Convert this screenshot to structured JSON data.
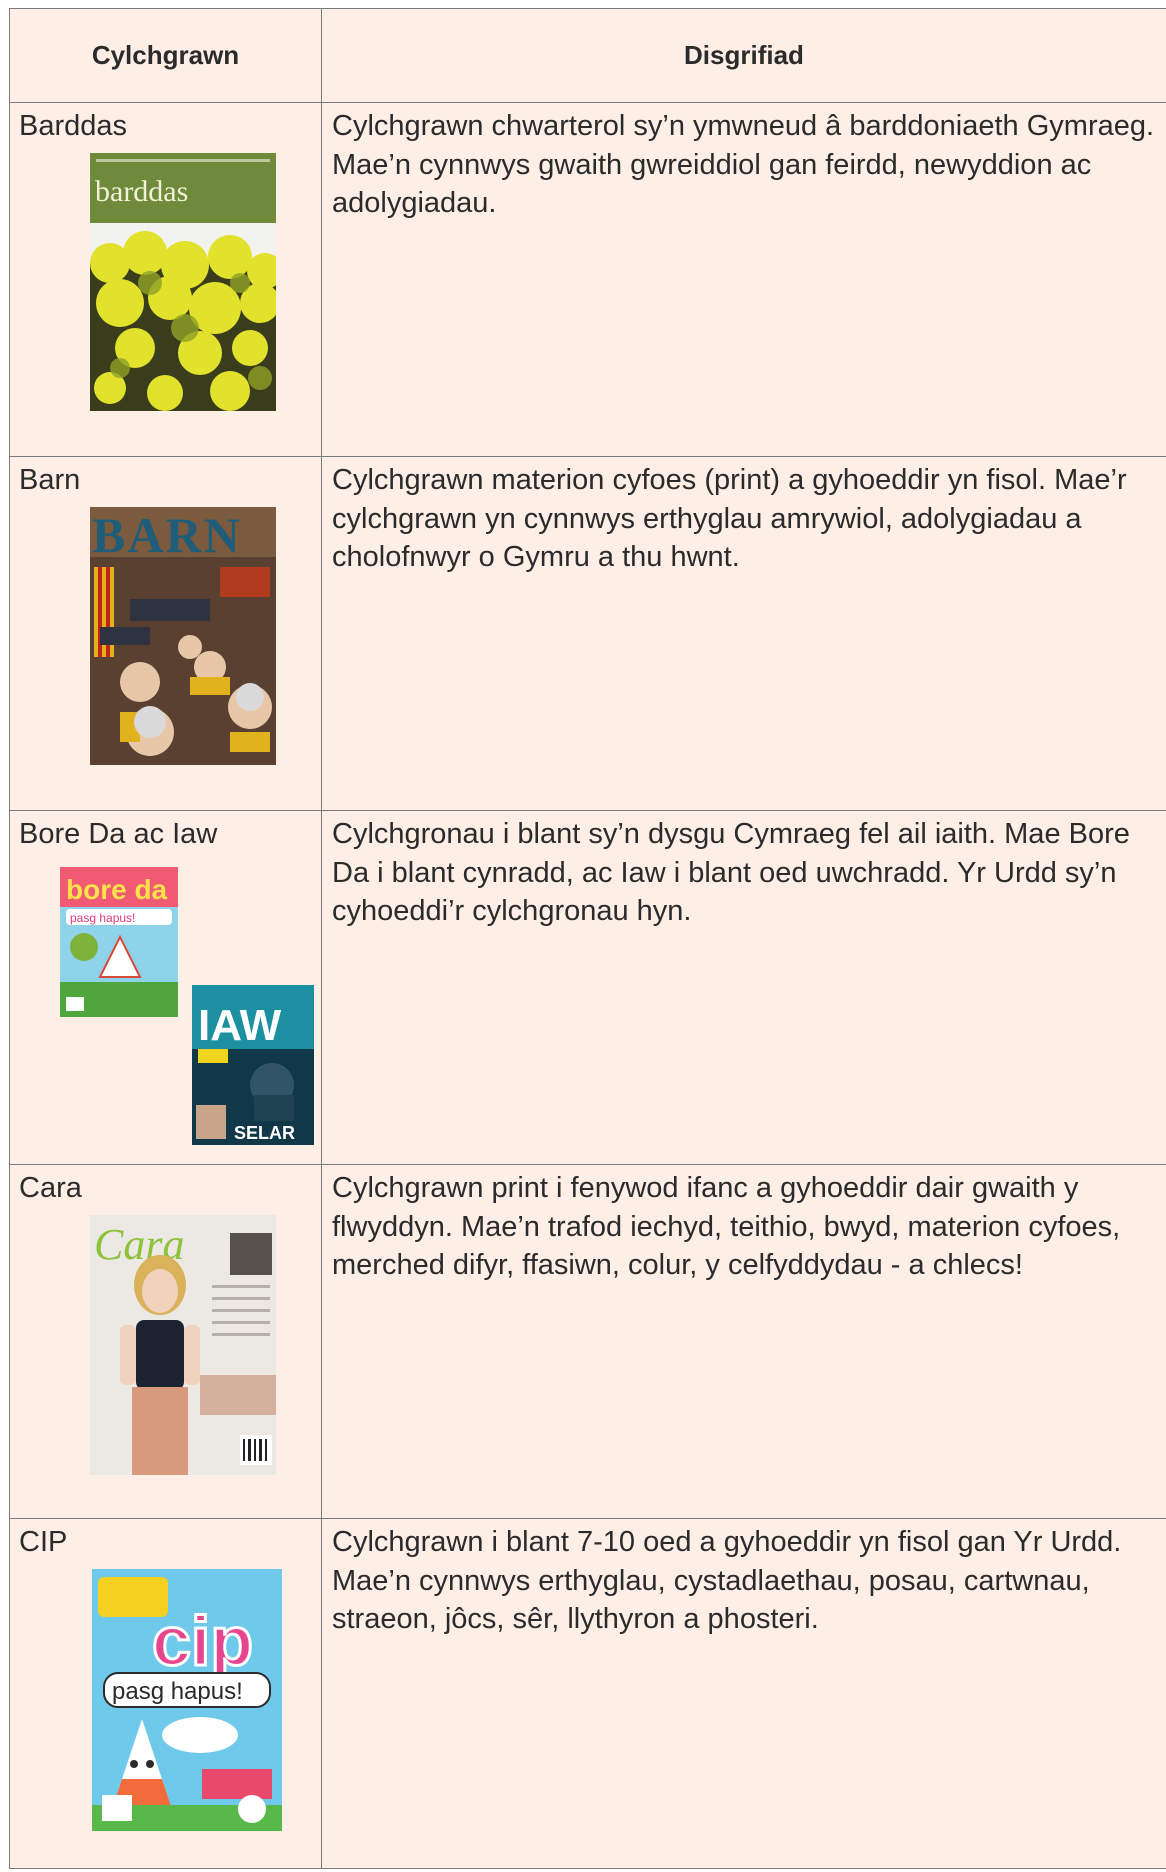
{
  "header": {
    "col1": "Cylchgrawn",
    "col2": "Disgrifiad"
  },
  "rows": [
    {
      "name": "Barddas",
      "description": "Cylchgrawn chwarterol sy’n ymwneud â barddoniaeth Gymraeg. Mae’n cynnwys gwaith gwreiddiol gan feirdd, newyddion ac adolygiadau.",
      "cover_title": "barddas"
    },
    {
      "name": "Barn",
      "description": "Cylchgrawn materion cyfoes (print) a gyhoeddir yn fisol. Mae’r cylchgrawn yn cynnwys erthyglau amrywiol, adolygiadau a cholofnwyr o Gymru a thu hwnt.",
      "cover_title": "BARN"
    },
    {
      "name": "Bore Da ac Iaw",
      "description": "Cylchgronau i blant sy’n dysgu Cymraeg fel ail iaith. Mae Bore Da i blant cynradd, ac Iaw i blant oed uwchradd. Yr Urdd sy’n cyhoeddi’r cylchgronau hyn.",
      "cover_title": "bore da",
      "cover_title_2": "IAW",
      "cover_subtitle": "pasg hapus!",
      "cover_footer": "SELAR"
    },
    {
      "name": "Cara",
      "description": "Cylchgrawn print i fenywod ifanc a gyhoeddir dair gwaith y flwyddyn. Mae’n trafod iechyd, teithio, bwyd, materion cyfoes, merched difyr, ffasiwn, colur, y celfyddydau - a chlecs!",
      "cover_title": "Cara"
    },
    {
      "name": "CIP",
      "description": "Cylchgrawn i blant 7-10 oed a gyhoeddir yn fisol gan Yr Urdd. Mae’n cynnwys erthyglau, cystadlaethau, posau, cartwnau, straeon, jôcs, sêr, llythyron a phosteri.",
      "cover_title": "cip",
      "cover_subtitle": "pasg hapus!"
    }
  ],
  "colors": {
    "background": "#fdeee6",
    "border": "#7a7a7a",
    "text": "#2b2b2b"
  }
}
